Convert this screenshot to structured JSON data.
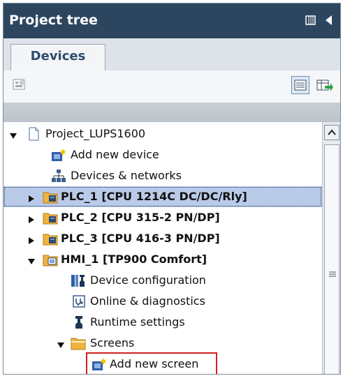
{
  "panel": {
    "title": "Project tree",
    "tab": "Devices"
  },
  "tree": {
    "root": "Project_LUPS1600",
    "add_new_device": "Add new device",
    "devices_networks": "Devices & networks",
    "plc1": "PLC_1 [CPU 1214C DC/DC/Rly]",
    "plc2": "PLC_2 [CPU 315-2 PN/DP]",
    "plc3": "PLC_3 [CPU 416-3 PN/DP]",
    "hmi1": "HMI_1 [TP900 Comfort]",
    "device_configuration": "Device configuration",
    "online_diagnostics": "Online & diagnostics",
    "runtime_settings": "Runtime settings",
    "screens": "Screens",
    "add_new_screen": "Add new screen"
  },
  "colors": {
    "title_bar": "#2c4660",
    "selection": "#b9cbe8",
    "highlight_box": "#d42020",
    "folder": "#f0b43c"
  }
}
